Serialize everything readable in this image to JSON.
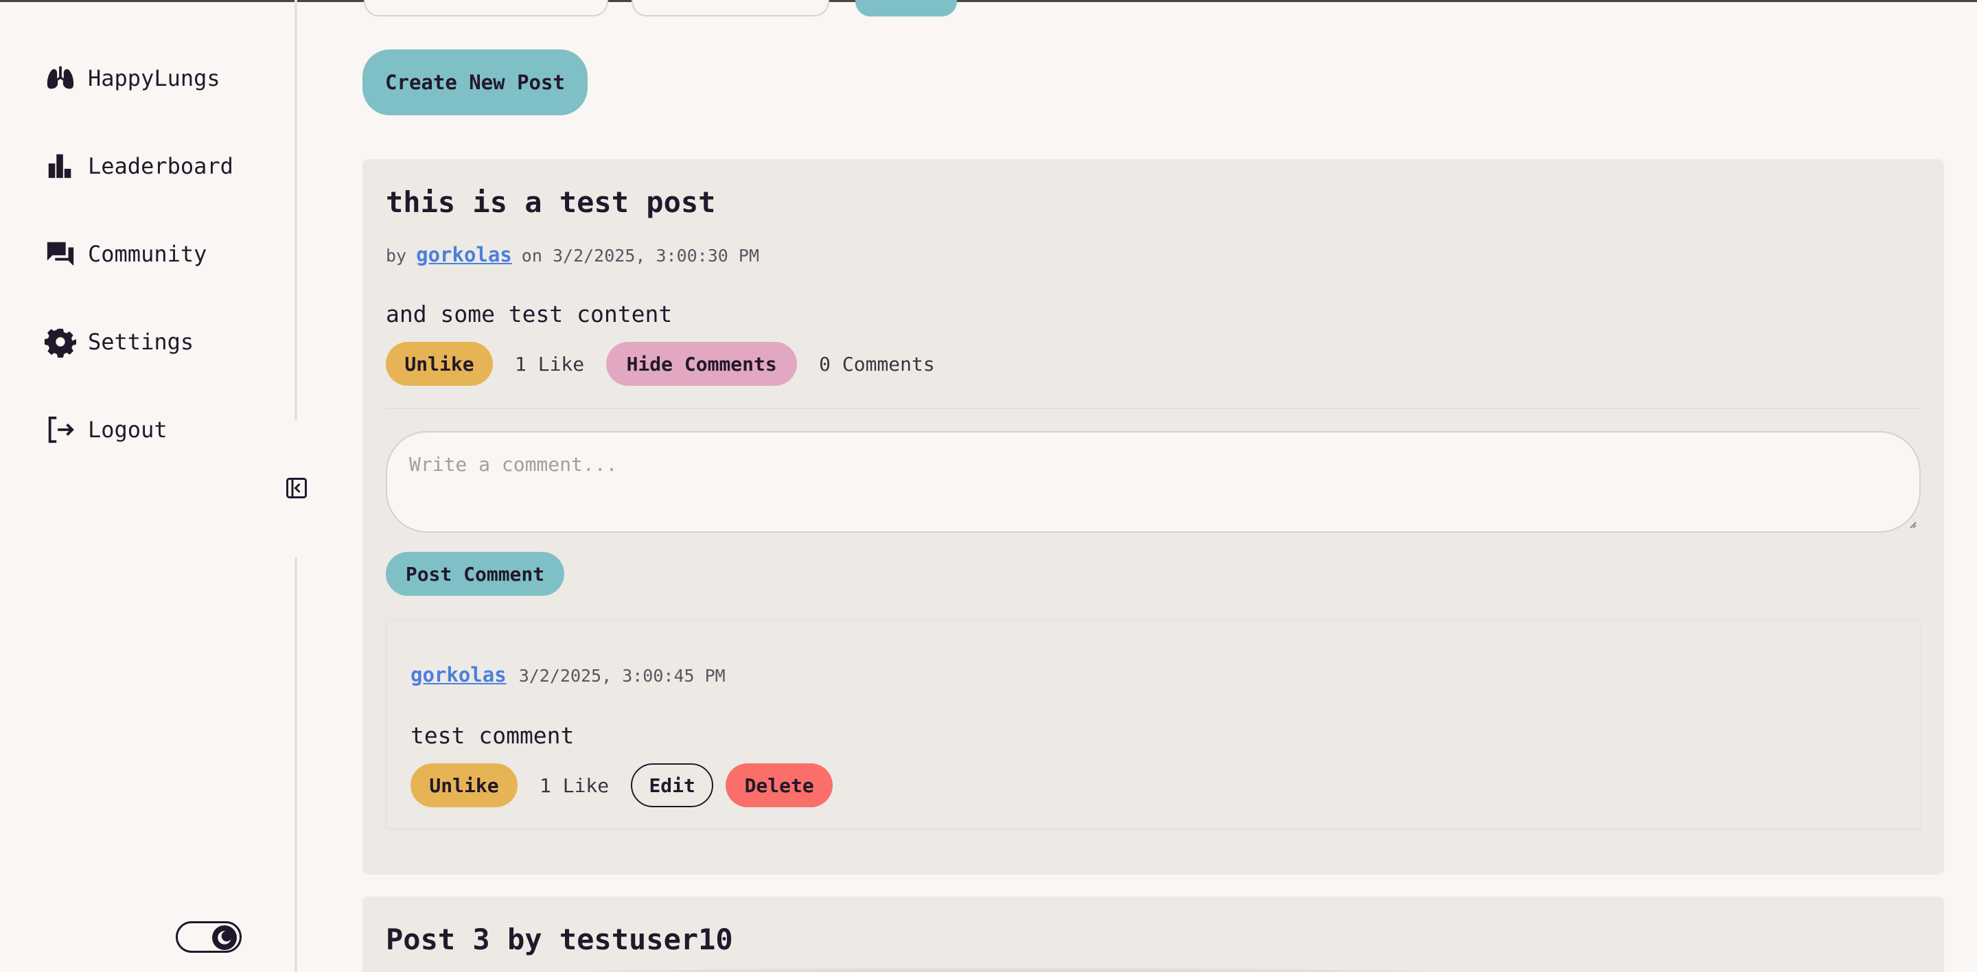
{
  "sidebar": {
    "items": [
      {
        "label": "HappyLungs",
        "icon": "lungs-icon"
      },
      {
        "label": "Leaderboard",
        "icon": "bar-chart-icon"
      },
      {
        "label": "Community",
        "icon": "chat-icon"
      },
      {
        "label": "Settings",
        "icon": "gear-icon"
      },
      {
        "label": "Logout",
        "icon": "logout-icon"
      }
    ],
    "collapse_icon": "collapse-sidebar-icon",
    "theme_toggle_icon": "moon-icon"
  },
  "main": {
    "create_post_label": "Create New Post",
    "post": {
      "title": "this is a test post",
      "by_label": "by",
      "author": "gorkolas",
      "on_label": "on",
      "timestamp": "3/2/2025, 3:00:30 PM",
      "content": "and some test content",
      "like_button": "Unlike",
      "like_count": "1 Like",
      "toggle_comments": "Hide Comments",
      "comment_count": "0 Comments",
      "comment_placeholder": "Write a comment...",
      "post_comment_button": "Post Comment",
      "comments": [
        {
          "author": "gorkolas",
          "timestamp": "3/2/2025, 3:00:45 PM",
          "text": "test comment",
          "like_button": "Unlike",
          "like_count": "1 Like",
          "edit_button": "Edit",
          "delete_button": "Delete"
        }
      ]
    },
    "next_post": {
      "title": "Post 3 by testuser10"
    }
  },
  "colors": {
    "background": "#faf6f3",
    "card": "#edeae6",
    "teal": "#7fc0c6",
    "gold": "#e6b454",
    "pink": "#e3a8c1",
    "red": "#fb6f6b",
    "link": "#4c7fdb",
    "text": "#22182b"
  }
}
